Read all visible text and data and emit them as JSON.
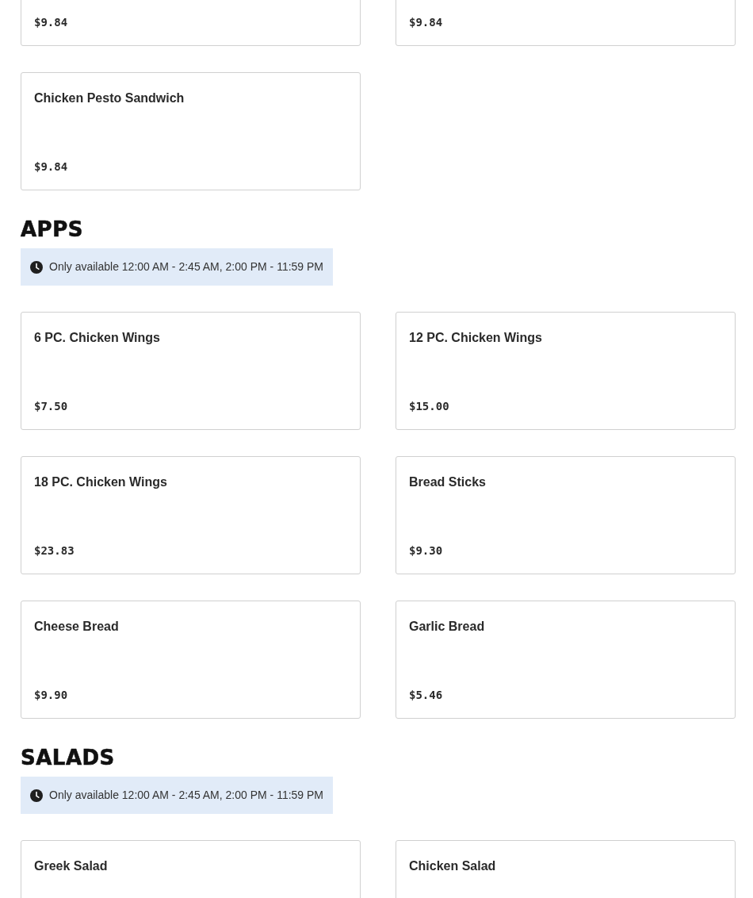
{
  "sections": [
    {
      "items": [
        {
          "price": "$9.84"
        },
        {
          "price": "$9.84"
        },
        {
          "name": "Chicken Pesto Sandwich",
          "price": "$9.84"
        }
      ]
    },
    {
      "title": "APPS",
      "availability": "Only available 12:00 AM - 2:45 AM, 2:00 PM - 11:59 PM",
      "items": [
        {
          "name": "6 PC. Chicken Wings",
          "price": "$7.50"
        },
        {
          "name": "12 PC. Chicken Wings",
          "price": "$15.00"
        },
        {
          "name": "18 PC. Chicken Wings",
          "price": "$23.83"
        },
        {
          "name": "Bread Sticks",
          "price": "$9.30"
        },
        {
          "name": "Cheese Bread",
          "price": "$9.90"
        },
        {
          "name": "Garlic Bread",
          "price": "$5.46"
        }
      ]
    },
    {
      "title": "SALADS",
      "availability": "Only available 12:00 AM - 2:45 AM, 2:00 PM - 11:59 PM",
      "items": [
        {
          "name": "Greek Salad"
        },
        {
          "name": "Chicken Salad"
        }
      ]
    }
  ]
}
